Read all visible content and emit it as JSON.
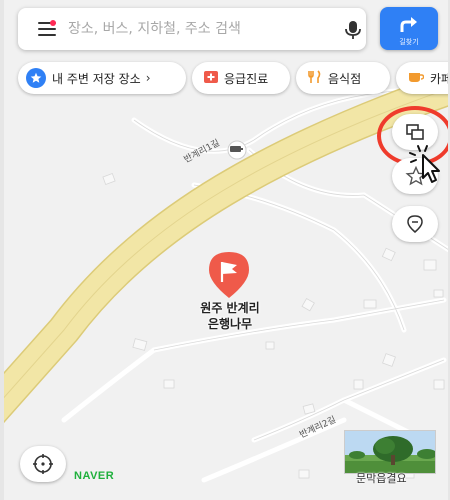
{
  "search": {
    "placeholder": "장소, 버스, 지하철, 주소 검색"
  },
  "route_button": {
    "label": "길찾기"
  },
  "chips": {
    "saved": "내 주변 저장 장소",
    "emergency": "응급진료",
    "food": "음식점",
    "cafe": "카페"
  },
  "map": {
    "place_name_line1": "원주 반계리",
    "place_name_line2": "은행나무",
    "road_label_top": "반계리1길",
    "road_label_bottom": "반계리2길",
    "photo_caption": "문막읍결요"
  },
  "branding": {
    "logo": "NAVER"
  },
  "colors": {
    "accent": "#2f80f5",
    "marker": "#ef5a4a",
    "highway": "#f2e6a6",
    "highway_edge": "#dccb78",
    "naver_green": "#1fb03c",
    "highlight": "#ef3b2c"
  },
  "icons": {
    "menu": "menu-icon",
    "mic": "mic-icon",
    "route": "route-arrow-icon",
    "star": "star-icon",
    "hospital": "hospital-cross-icon",
    "food": "fork-knife-icon",
    "cafe": "coffee-cup-icon",
    "layers": "layers-icon",
    "favorite": "star-outline-icon",
    "pin_toggle": "map-pin-icon",
    "locate": "compass-icon",
    "cursor": "mouse-cursor-icon",
    "cctv": "cctv-icon"
  }
}
